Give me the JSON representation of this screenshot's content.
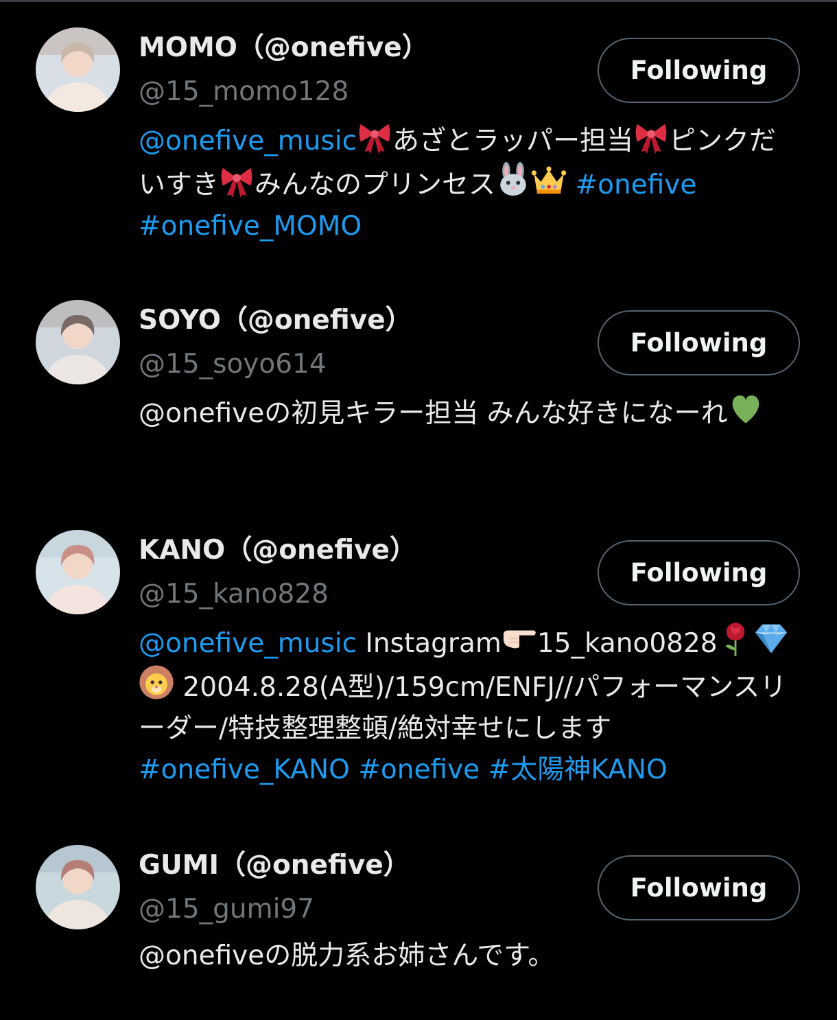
{
  "users": [
    {
      "name": "MOMO（@onefive）",
      "handle": "@15_momo128",
      "button": "Following",
      "bio": [
        {
          "t": "link",
          "v": "@onefive_music"
        },
        {
          "t": "emoji",
          "icon": "ribbon-icon"
        },
        {
          "t": "text",
          "v": "あざとラッパー担当"
        },
        {
          "t": "emoji",
          "icon": "ribbon-icon"
        },
        {
          "t": "text",
          "v": "ピンクだいすき"
        },
        {
          "t": "emoji",
          "icon": "ribbon-icon"
        },
        {
          "t": "text",
          "v": "みんなのプリンセス"
        },
        {
          "t": "emoji",
          "icon": "rabbit-face-icon"
        },
        {
          "t": "emoji",
          "icon": "crown-icon"
        },
        {
          "t": "text",
          "v": " "
        },
        {
          "t": "link",
          "v": "#onefive"
        },
        {
          "t": "text",
          "v": " "
        },
        {
          "t": "link",
          "v": "#onefive_MOMO"
        }
      ]
    },
    {
      "name": "SOYO（@onefive）",
      "handle": "@15_soyo614",
      "button": "Following",
      "bio": [
        {
          "t": "text",
          "v": "@onefiveの初見キラー担当 みんな好きになーれ"
        },
        {
          "t": "emoji",
          "icon": "green-heart-icon"
        }
      ]
    },
    {
      "name": "KANO（@onefive）",
      "handle": "@15_kano828",
      "button": "Following",
      "bio": [
        {
          "t": "link",
          "v": "@onefive_music"
        },
        {
          "t": "text",
          "v": " Instagram"
        },
        {
          "t": "emoji",
          "icon": "pointing-right-icon"
        },
        {
          "t": "text",
          "v": "15_kano0828"
        },
        {
          "t": "emoji",
          "icon": "rose-icon"
        },
        {
          "t": "emoji",
          "icon": "gem-icon"
        },
        {
          "t": "emoji",
          "icon": "lion-face-icon"
        },
        {
          "t": "text",
          "v": " 2004.8.28(A型)/159cm/ENFJ//パフォーマンスリーダー/特技整理整頓/絶対幸せにします "
        },
        {
          "t": "link",
          "v": "#onefive_KANO"
        },
        {
          "t": "text",
          "v": " "
        },
        {
          "t": "link",
          "v": "#onefive"
        },
        {
          "t": "text",
          "v": " "
        },
        {
          "t": "link",
          "v": "#太陽神KANO"
        }
      ]
    },
    {
      "name": "GUMI（@onefive）",
      "handle": "@15_gumi97",
      "button": "Following",
      "bio": [
        {
          "t": "text",
          "v": "@onefiveの脱力系お姉さんです。"
        }
      ]
    }
  ],
  "colors": {
    "background": "#000000",
    "text": "#e7e9ea",
    "secondary": "#71767b",
    "link": "#1d9bf0",
    "button_border": "#536471"
  }
}
